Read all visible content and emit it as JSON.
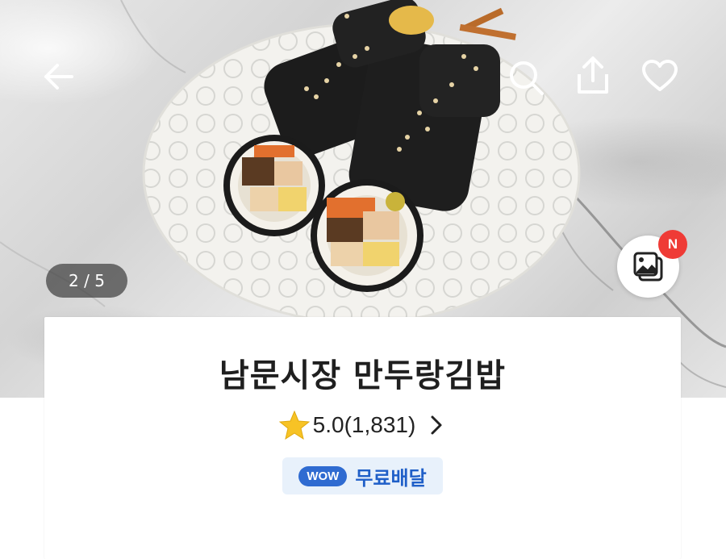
{
  "hero": {
    "image_counter": "2 / 5",
    "new_badge": "N"
  },
  "icons": {
    "back": "arrow-left-icon",
    "search": "search-icon",
    "share": "share-icon",
    "favorite": "heart-icon",
    "photo_review": "photo-gallery-icon",
    "rating_star": "star-icon",
    "rating_chevron": "chevron-right-icon"
  },
  "store": {
    "name": "남문시장 만두랑김밥",
    "rating": "5.0(1,831)",
    "wow_label": "WOW",
    "delivery_label": "무료배달"
  },
  "colors": {
    "accent_blue": "#2f6bd1",
    "badge_bg": "#e8f1fb",
    "new_badge": "#ef3b36",
    "star": "#f7c325"
  }
}
